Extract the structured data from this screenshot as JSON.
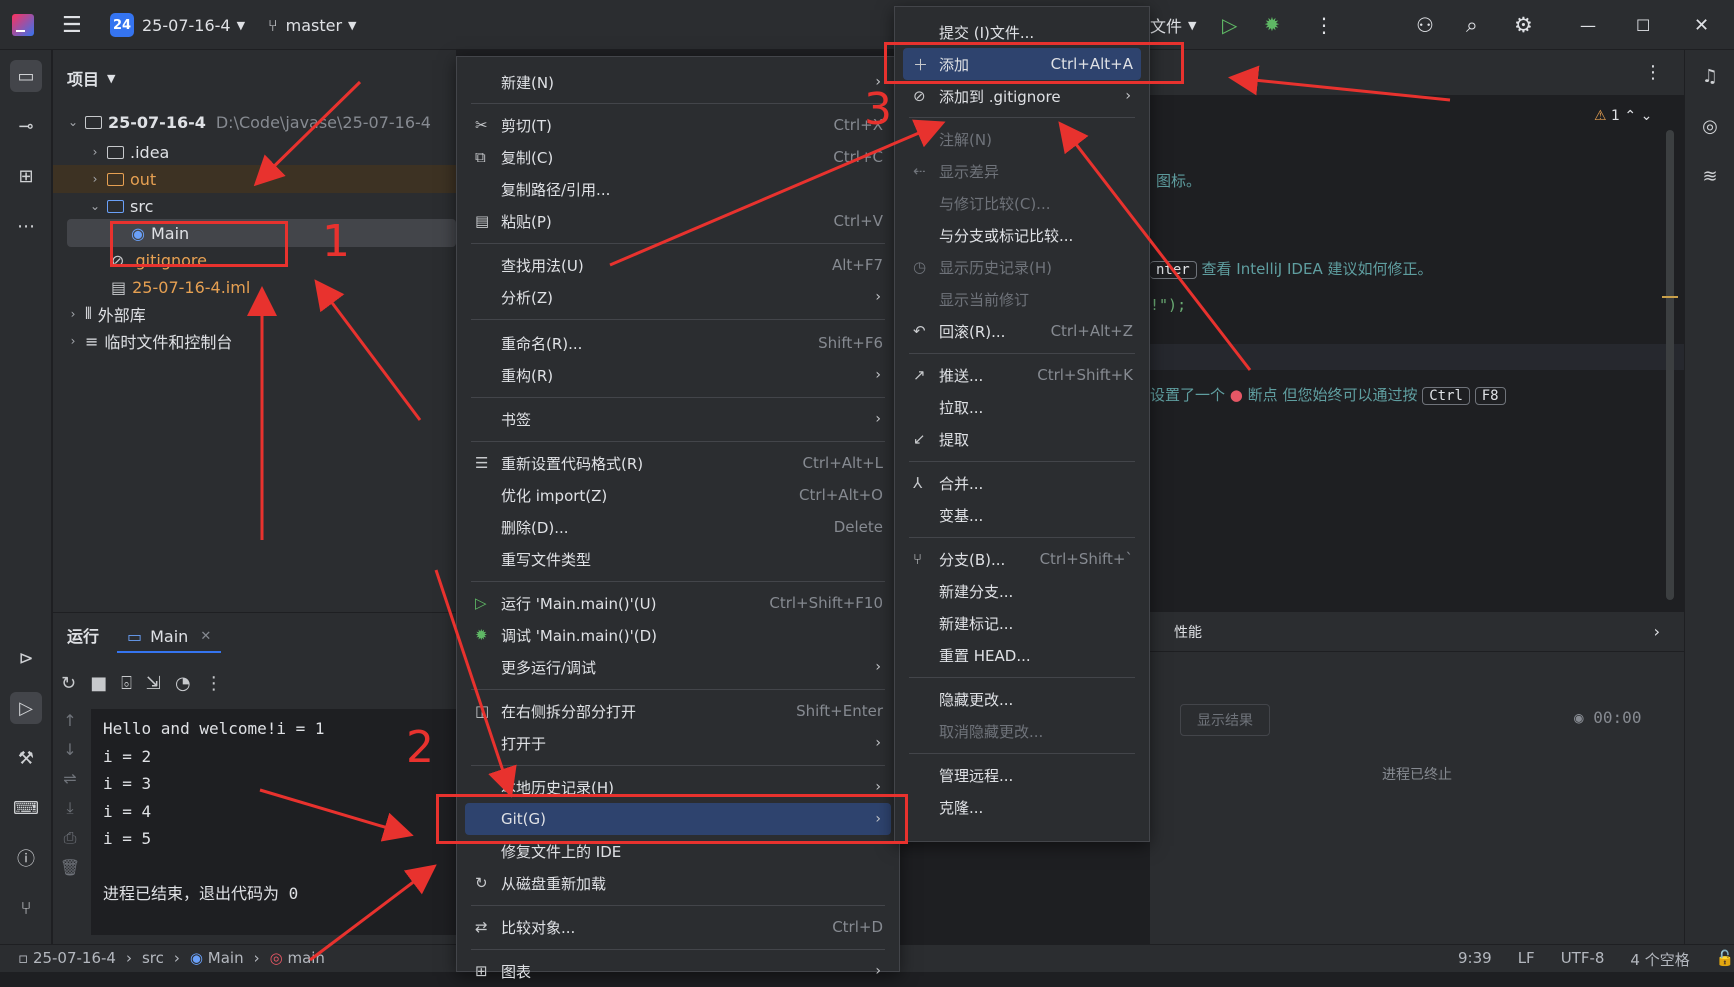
{
  "title_bar": {
    "project_badge": "24",
    "project_name": "25-07-16-4",
    "branch": "master",
    "file_menu": "文件"
  },
  "project_panel": {
    "title": "项目",
    "root_name": "25-07-16-4",
    "root_path": "D:\\Code\\javase\\25-07-16-4",
    "items": {
      "idea": ".idea",
      "out": "out",
      "src": "src",
      "main": "Main",
      "gitignore": ".gitignore",
      "iml": "25-07-16-4.iml",
      "ext_libs": "外部库",
      "scratches": "临时文件和控制台"
    }
  },
  "run_panel": {
    "tab_run": "运行",
    "tab_main": "Main",
    "console_lines": [
      "Hello and welcome!i = 1",
      "i = 2",
      "i = 3",
      "i = 4",
      "i = 5",
      "",
      "进程已结束，退出代码为 0"
    ]
  },
  "context_menu": {
    "new": "新建(N)",
    "cut": "剪切(T)",
    "cut_sc": "Ctrl+X",
    "copy": "复制(C)",
    "copy_sc": "Ctrl+C",
    "copy_path": "复制路径/引用...",
    "paste": "粘贴(P)",
    "paste_sc": "Ctrl+V",
    "find_usages": "查找用法(U)",
    "find_usages_sc": "Alt+F7",
    "analyze": "分析(Z)",
    "rename": "重命名(R)...",
    "rename_sc": "Shift+F6",
    "refactor": "重构(R)",
    "bookmarks": "书签",
    "reformat": "重新设置代码格式(R)",
    "reformat_sc": "Ctrl+Alt+L",
    "optimize": "优化 import(Z)",
    "optimize_sc": "Ctrl+Alt+O",
    "delete": "删除(D)...",
    "delete_sc": "Delete",
    "override_type": "重写文件类型",
    "run": "运行 'Main.main()'(U)",
    "run_sc": "Ctrl+Shift+F10",
    "debug": "调试 'Main.main()'(D)",
    "more_run": "更多运行/调试",
    "open_split": "在右侧拆分部分打开",
    "open_split_sc": "Shift+Enter",
    "open_in": "打开于",
    "local_history": "本地历史记录(H)",
    "git": "Git(G)",
    "repair_ide": "修复文件上的 IDE",
    "reload": "从磁盘重新加载",
    "compare": "比较对象...",
    "compare_sc": "Ctrl+D",
    "diagram": "图表"
  },
  "git_menu": {
    "commit": "提交 (I)文件...",
    "add": "添加",
    "add_sc": "Ctrl+Alt+A",
    "add_gitignore": "添加到 .gitignore",
    "annotate": "注解(N)",
    "show_diff": "显示差异",
    "compare_revision": "与修订比较(C)...",
    "compare_branch": "与分支或标记比较...",
    "show_history": "显示历史记录(H)",
    "show_current": "显示当前修订",
    "rollback": "回滚(R)...",
    "rollback_sc": "Ctrl+Alt+Z",
    "push": "推送...",
    "push_sc": "Ctrl+Shift+K",
    "pull": "拉取...",
    "fetch": "提取",
    "merge": "合并...",
    "rebase": "变基...",
    "branches": "分支(B)...",
    "branches_sc": "Ctrl+Shift+`",
    "new_branch": "新建分支...",
    "new_tag": "新建标记...",
    "reset_head": "重置 HEAD...",
    "shelve": "隐藏更改...",
    "unshelve": "取消隐藏更改...",
    "remotes": "管理远程...",
    "clone": "克隆..."
  },
  "editor": {
    "hint1": "图标。",
    "hint2_pre": "nter",
    "hint2": "查看 IntelliJ IDEA 建议如何修正。",
    "code_tail": "!\");",
    "hint3_pre": "设置了一个",
    "hint3_mid": "断点 但您始终可以通过按",
    "key1": "Ctrl",
    "key2": "F8",
    "warnings": "1"
  },
  "perf_panel": {
    "title": "性能",
    "show_results": "显示结果",
    "timer": "00:00",
    "status": "进程已终止"
  },
  "status_bar": {
    "crumb_project": "25-07-16-4",
    "crumb_src": "src",
    "crumb_main": "Main",
    "crumb_method": "main",
    "position": "9:39",
    "line_sep": "LF",
    "encoding": "UTF-8",
    "indent": "4 个空格"
  },
  "annotations": {
    "n1": "1",
    "n2": "2",
    "n3": "3"
  },
  "colors": {
    "accent": "#3574f0",
    "annotation": "#e8322e",
    "selection": "#2e436e"
  }
}
